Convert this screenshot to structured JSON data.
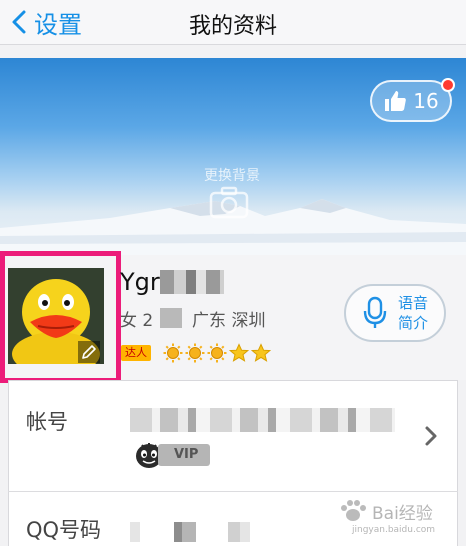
{
  "nav": {
    "back_label": "设置",
    "title": "我的资料"
  },
  "cover": {
    "change_background": "更换背景",
    "like_count": "16"
  },
  "profile": {
    "nickname_visible": "Ygr",
    "gender_age": "女 2",
    "location": "广东 深圳",
    "badge": "达人",
    "sun_level_count": 3,
    "star_level_count": 2,
    "voice_intro": "语音简介"
  },
  "list": {
    "rows": [
      {
        "label": "帐号",
        "vip_tag": "VIP"
      },
      {
        "label": "QQ号码"
      }
    ]
  },
  "watermark": {
    "main": "Bai经验",
    "sub": "jingyan.baidu.com"
  },
  "colors": {
    "accent": "#1690e6",
    "highlight": "#ec1c7a",
    "like_dot": "#ff3b30"
  }
}
